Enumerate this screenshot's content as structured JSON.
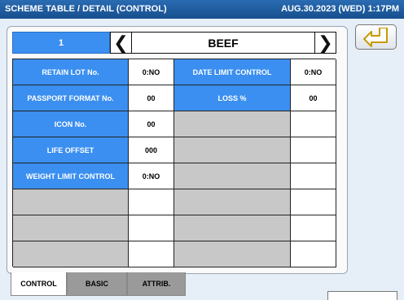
{
  "header": {
    "title": "SCHEME TABLE / DETAIL (CONTROL)",
    "datetime": "AUG.30.2023 (WED)  1:17PM"
  },
  "record": {
    "number": "1",
    "name": "BEEF",
    "prev_icon": "chevron-left-icon",
    "next_icon": "chevron-right-icon",
    "back_icon": "return-arrow-icon"
  },
  "fields": {
    "retain_lot_label": "RETAIN LOT No.",
    "retain_lot_value": "0:NO",
    "date_limit_label": "DATE LIMIT CONTROL",
    "date_limit_value": "0:NO",
    "passport_label": "PASSPORT FORMAT No.",
    "passport_value": "00",
    "loss_label": "LOSS %",
    "loss_value": "00",
    "icon_label": "ICON No.",
    "icon_value": "00",
    "life_offset_label": "LIFE OFFSET",
    "life_offset_value": "000",
    "weight_limit_label": "WEIGHT LIMIT CONTROL",
    "weight_limit_value": "0:NO"
  },
  "tabs": {
    "control": "CONTROL",
    "basic": "BASIC",
    "attrib": "ATTRIB."
  },
  "colors": {
    "header": "#1d5ba0",
    "label_blue": "#3b8ff0",
    "empty_grey": "#c8c8c8"
  }
}
